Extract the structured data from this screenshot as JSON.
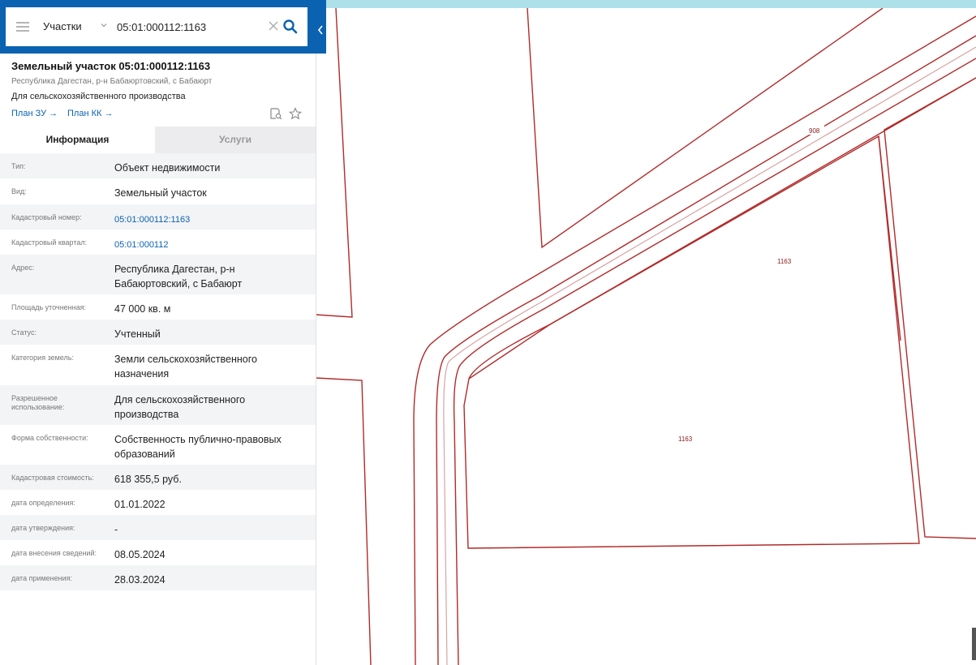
{
  "search": {
    "layer": "Участки",
    "query": "05:01:000112:1163"
  },
  "object": {
    "title": "Земельный участок 05:01:000112:1163",
    "address": "Республика Дагестан, р-н Бабаюртовский, с Бабаюрт",
    "purpose": "Для сельскохозяйственного производства",
    "plan_zu": "План ЗУ",
    "plan_kk": "План КК"
  },
  "tabs": {
    "info": "Информация",
    "services": "Услуги"
  },
  "rows": [
    {
      "label": "Тип:",
      "value": "Объект недвижимости"
    },
    {
      "label": "Вид:",
      "value": "Земельный участок"
    },
    {
      "label": "Кадастровый номер:",
      "value": "05:01:000112:1163"
    },
    {
      "label": "Кадастровый квартал:",
      "value": "05:01:000112"
    },
    {
      "label": "Адрес:",
      "value": "Республика Дагестан, р-н Бабаюртовский, с Бабаюрт"
    },
    {
      "label": "Площадь уточненная:",
      "value": "47 000 кв. м"
    },
    {
      "label": "Статус:",
      "value": "Учтенный"
    },
    {
      "label": "Категория земель:",
      "value": "Земли сельскохозяйственного назначения"
    },
    {
      "label": "Разрешенное использование:",
      "value": "Для сельскохозяйственного производства"
    },
    {
      "label": "Форма собственности:",
      "value": "Собственность публично-правовых образований"
    },
    {
      "label": "Кадастровая стоимость:",
      "value": "618 355,5 руб."
    },
    {
      "label": "дата определения:",
      "value": "01.01.2022"
    },
    {
      "label": "дата утверждения:",
      "value": "-"
    },
    {
      "label": "дата внесения сведений:",
      "value": "08.05.2024"
    },
    {
      "label": "дата применения:",
      "value": "28.03.2024"
    }
  ],
  "map": {
    "labels": [
      "908",
      "1163",
      "1163"
    ],
    "boundary_color": "#b22a2a",
    "road_axis_color": "#d9a3a3"
  },
  "colors": {
    "header_bg": "#0a62b0",
    "link": "#0a62b0",
    "top_strip": "#aee0ea"
  }
}
